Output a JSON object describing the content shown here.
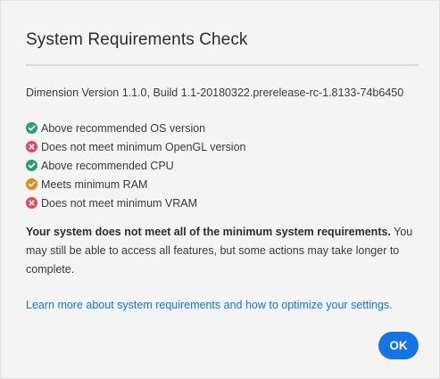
{
  "dialog": {
    "title": "System Requirements Check",
    "version_line": "Dimension Version 1.1.0, Build 1.1-20180322.prerelease-rc-1.8133-74b6450",
    "checks": [
      {
        "status": "pass",
        "icon": "check-circle-icon",
        "label": "Above recommended OS version"
      },
      {
        "status": "fail",
        "icon": "x-circle-icon",
        "label": "Does not meet minimum OpenGL version"
      },
      {
        "status": "pass",
        "icon": "check-circle-icon",
        "label": "Above recommended CPU"
      },
      {
        "status": "warning",
        "icon": "check-circle-icon",
        "label": "Meets minimum RAM"
      },
      {
        "status": "fail",
        "icon": "x-circle-icon",
        "label": "Does not meet minimum VRAM"
      }
    ],
    "message_bold": "Your system does not meet all of the minimum system requirements.",
    "message_rest": " You may still be able to access all features, but some actions may take longer to complete.",
    "learn_more_link": "Learn more about system requirements and how to optimize your settings.",
    "ok_label": "OK"
  },
  "colors": {
    "pass": "#2d9d78",
    "fail": "#e34850",
    "warning": "#e68619",
    "accent": "#1473e6",
    "background": "#f4f4f4"
  }
}
